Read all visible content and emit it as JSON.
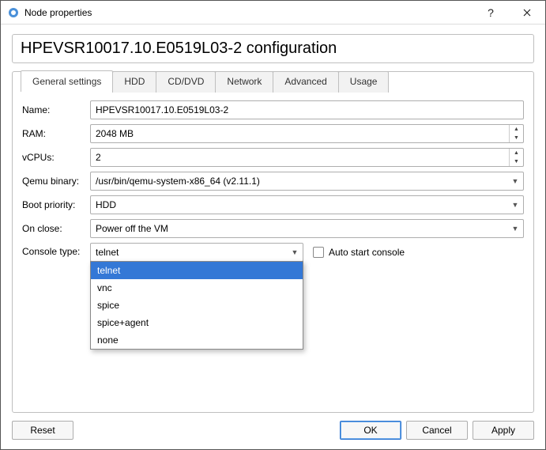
{
  "window": {
    "title": "Node properties"
  },
  "heading": "HPEVSR10017.10.E0519L03-2 configuration",
  "tabs": {
    "general": "General settings",
    "hdd": "HDD",
    "cddvd": "CD/DVD",
    "network": "Network",
    "advanced": "Advanced",
    "usage": "Usage"
  },
  "labels": {
    "name": "Name:",
    "ram": "RAM:",
    "vcpus": "vCPUs:",
    "qemu": "Qemu binary:",
    "boot": "Boot priority:",
    "onclose": "On close:",
    "console": "Console type:",
    "autostart": "Auto start console"
  },
  "values": {
    "name": "HPEVSR10017.10.E0519L03-2",
    "ram": "2048 MB",
    "vcpus": "2",
    "qemu": "/usr/bin/qemu-system-x86_64 (v2.11.1)",
    "boot": "HDD",
    "onclose": "Power off the VM",
    "console_selected": "telnet"
  },
  "console_options": [
    "telnet",
    "vnc",
    "spice",
    "spice+agent",
    "none"
  ],
  "buttons": {
    "reset": "Reset",
    "ok": "OK",
    "cancel": "Cancel",
    "apply": "Apply"
  }
}
